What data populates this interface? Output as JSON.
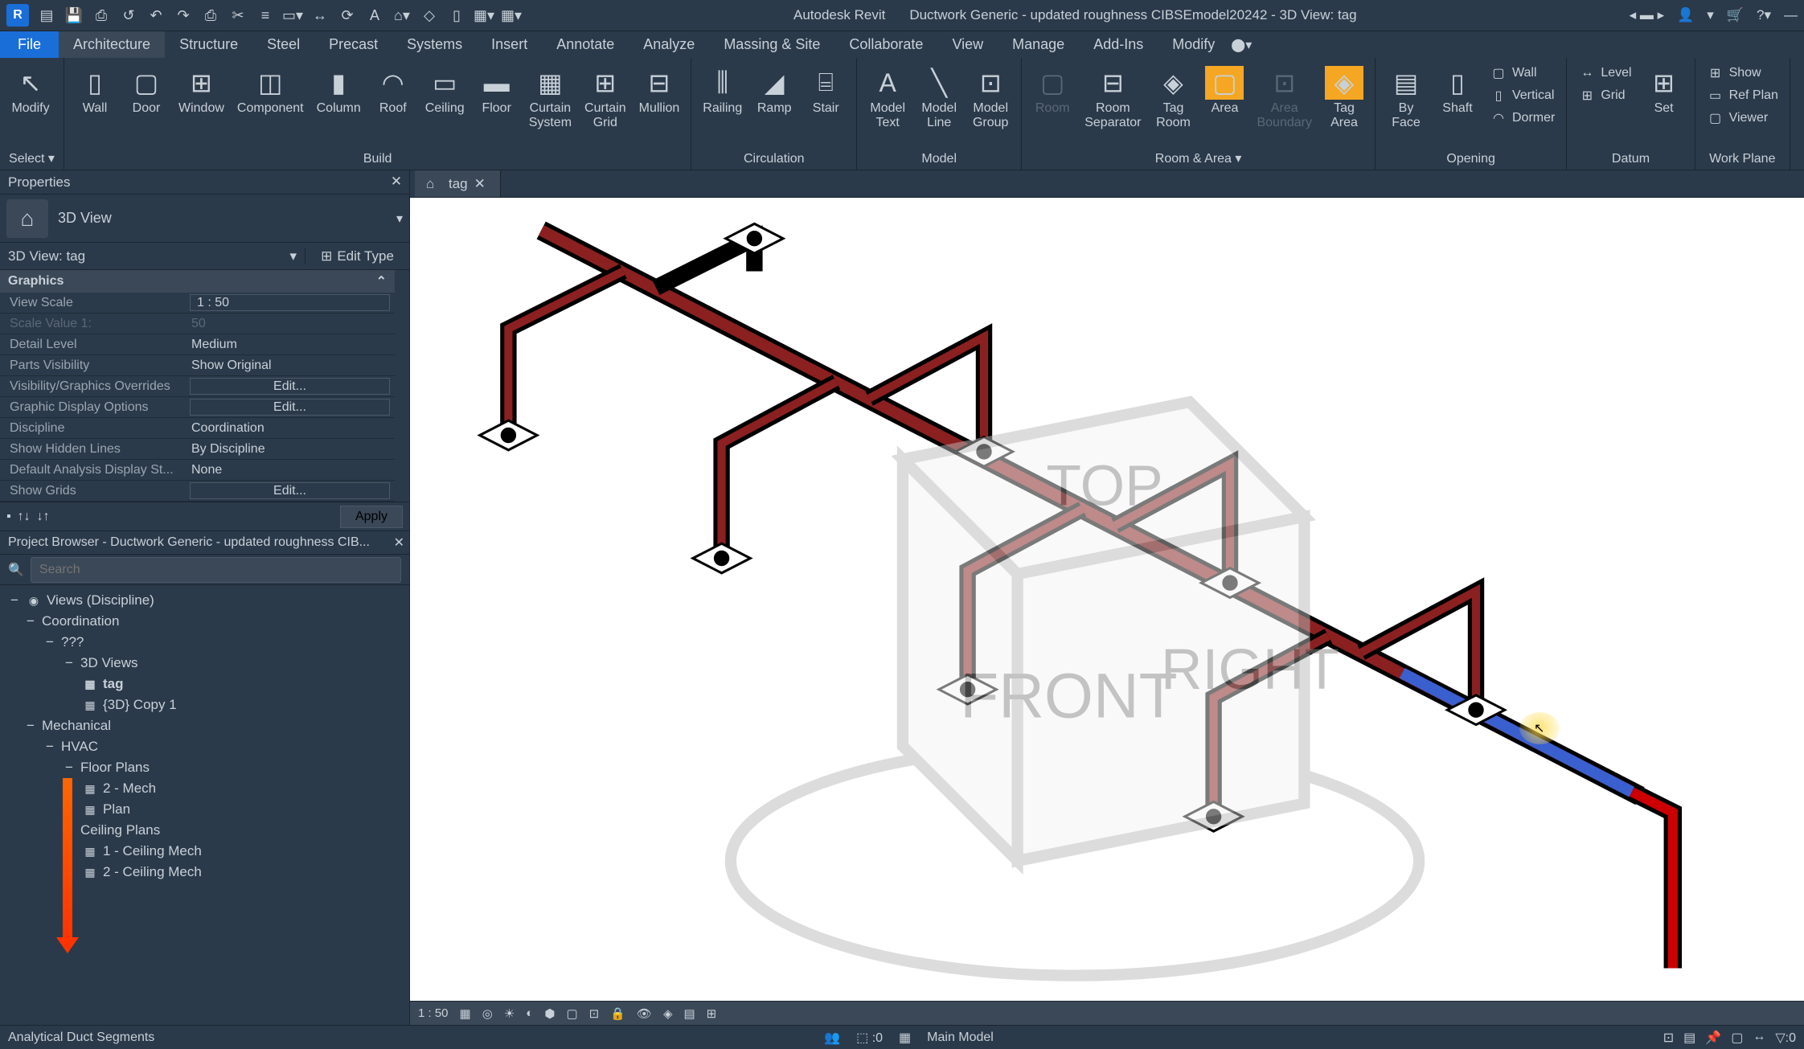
{
  "app": {
    "name": "Autodesk Revit",
    "document": "Ductwork Generic - updated roughness CIBSEmodel20242 - 3D View: tag"
  },
  "qat_icons": [
    "revit",
    "open",
    "save",
    "saveall",
    "sync",
    "undo",
    "redo",
    "|",
    "print",
    "measure",
    "|",
    "thin",
    "align",
    "|",
    "dim",
    "text",
    "|",
    "home",
    "back",
    "section",
    "|",
    "switch",
    "close"
  ],
  "menu": {
    "file": "File",
    "tabs": [
      "Architecture",
      "Structure",
      "Steel",
      "Precast",
      "Systems",
      "Insert",
      "Annotate",
      "Analyze",
      "Massing & Site",
      "Collaborate",
      "View",
      "Manage",
      "Add-Ins",
      "Modify"
    ],
    "active": "Architecture"
  },
  "ribbon": {
    "select": {
      "modify": "Modify",
      "label": "Select ▾"
    },
    "build": {
      "label": "Build",
      "items": [
        "Wall",
        "Door",
        "Window",
        "Component",
        "Column",
        "Roof",
        "Ceiling",
        "Floor",
        "Curtain\nSystem",
        "Curtain\nGrid",
        "Mullion"
      ]
    },
    "circulation": {
      "label": "Circulation",
      "items": [
        "Railing",
        "Ramp",
        "Stair"
      ]
    },
    "model": {
      "label": "Model",
      "items": [
        "Model\nText",
        "Model\nLine",
        "Model\nGroup"
      ]
    },
    "room_area": {
      "label": "Room & Area ▾",
      "room": "Room",
      "sep": "Room\nSeparator",
      "tag_room": "Tag\nRoom",
      "area": "Area",
      "area_boundary": "Area\nBoundary",
      "tag_area": "Tag\nArea"
    },
    "opening": {
      "label": "Opening",
      "by_face": "By\nFace",
      "shaft": "Shaft",
      "wall": "Wall",
      "vertical": "Vertical",
      "dormer": "Dormer"
    },
    "datum": {
      "label": "Datum",
      "level": "Level",
      "grid": "Grid",
      "set": "Set"
    },
    "workplane": {
      "label": "Work Plane",
      "show": "Show",
      "ref": "Ref Plan",
      "viewer": "Viewer"
    }
  },
  "properties": {
    "title": "Properties",
    "type_name": "3D View",
    "instance": "3D View: tag",
    "edit_type": "Edit Type",
    "group": "Graphics",
    "rows": [
      {
        "label": "View Scale",
        "value": "1 : 50",
        "input": true
      },
      {
        "label": "Scale Value   1:",
        "value": "50",
        "disabled": true
      },
      {
        "label": "Detail Level",
        "value": "Medium"
      },
      {
        "label": "Parts Visibility",
        "value": "Show Original"
      },
      {
        "label": "Visibility/Graphics Overrides",
        "value": "Edit...",
        "btn": true
      },
      {
        "label": "Graphic Display Options",
        "value": "Edit...",
        "btn": true
      },
      {
        "label": "Discipline",
        "value": "Coordination"
      },
      {
        "label": "Show Hidden Lines",
        "value": "By Discipline"
      },
      {
        "label": "Default Analysis Display St...",
        "value": "None"
      },
      {
        "label": "Show Grids",
        "value": "Edit...",
        "btn": true
      }
    ],
    "apply": "Apply"
  },
  "browser": {
    "title": "Project Browser - Ductwork Generic - updated roughness CIB...",
    "search_placeholder": "Search",
    "root": "Views (Discipline)",
    "tree": [
      {
        "level": 1,
        "exp": "−",
        "label": "Coordination"
      },
      {
        "level": 2,
        "exp": "−",
        "label": "???"
      },
      {
        "level": 3,
        "exp": "−",
        "label": "3D Views"
      },
      {
        "level": 4,
        "icon": "▦",
        "label": "tag",
        "bold": true
      },
      {
        "level": 4,
        "icon": "▦",
        "label": "{3D} Copy 1"
      },
      {
        "level": 1,
        "exp": "−",
        "label": "Mechanical"
      },
      {
        "level": 2,
        "exp": "−",
        "label": "HVAC"
      },
      {
        "level": 3,
        "exp": "−",
        "label": "Floor Plans"
      },
      {
        "level": 4,
        "icon": "▦",
        "label": "2 - Mech"
      },
      {
        "level": 4,
        "icon": "▦",
        "label": "Plan"
      },
      {
        "level": 3,
        "exp": "−",
        "label": "Ceiling Plans"
      },
      {
        "level": 4,
        "icon": "▦",
        "label": "1 - Ceiling Mech"
      },
      {
        "level": 4,
        "icon": "▦",
        "label": "2 - Ceiling Mech"
      }
    ]
  },
  "view_tab": {
    "name": "tag"
  },
  "view_controls": {
    "scale": "1 : 50"
  },
  "statusbar": {
    "left": "Analytical Duct Segments",
    "model": "Main Model",
    "zero": ":0"
  }
}
